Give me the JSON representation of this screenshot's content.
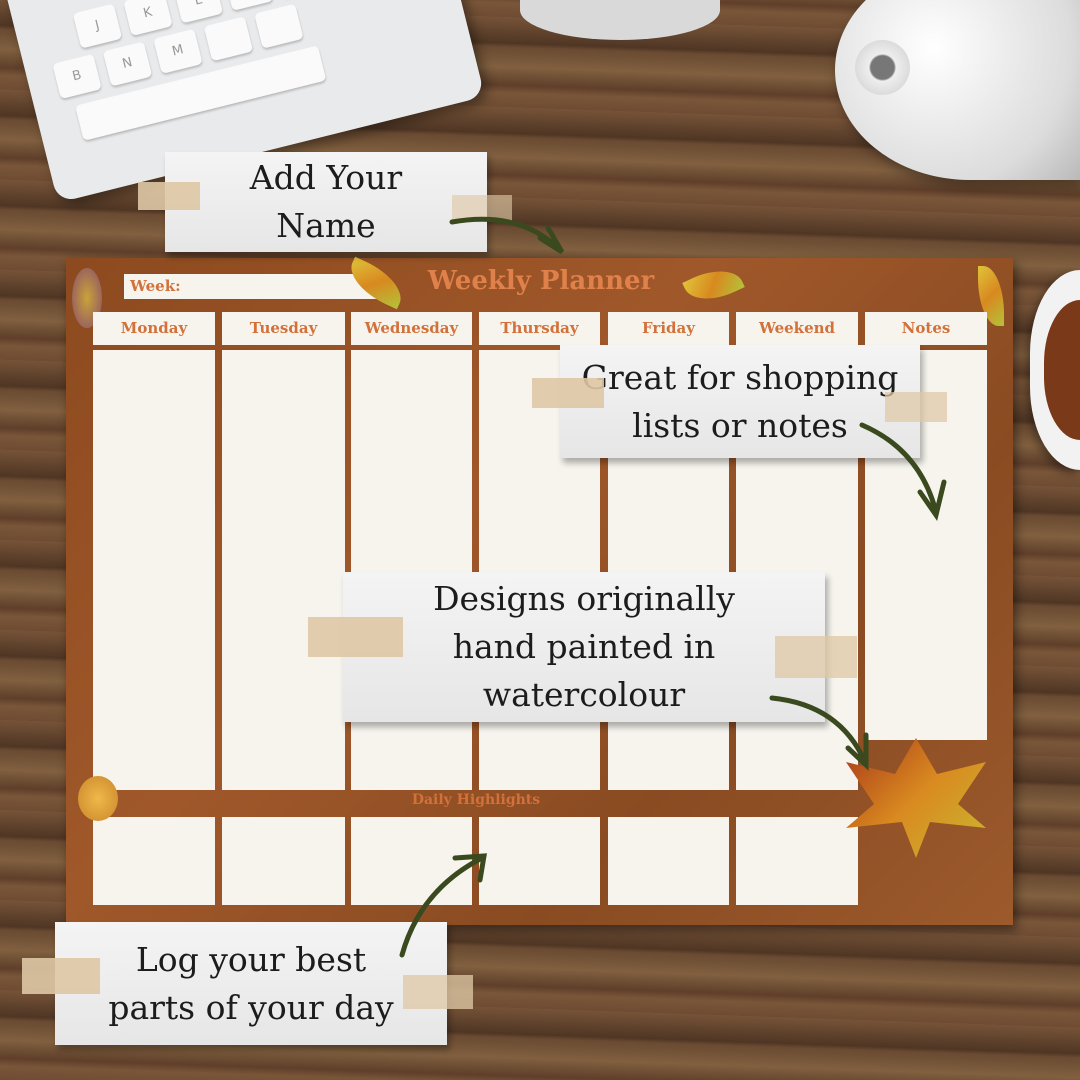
{
  "planner": {
    "title": "Weekly Planner",
    "week_label": "Week:",
    "columns": [
      "Monday",
      "Tuesday",
      "Wednesday",
      "Thursday",
      "Friday",
      "Weekend",
      "Notes"
    ],
    "highlights_title": "Daily Highlights"
  },
  "callouts": {
    "name": "Add Your\nName",
    "shopping": "Great for shopping\nlists or notes",
    "designs": "Designs originally\nhand painted in\nwatercolour",
    "log": "Log your best\nparts of your day"
  },
  "keyboard_keys": [
    "J",
    "K",
    "L",
    "N",
    "M",
    "B"
  ],
  "colors": {
    "planner_brown": "#9a5428",
    "heading_orange": "#d2713a",
    "arrow_green": "#3a4a1e",
    "paper": "#f7f4ee"
  }
}
